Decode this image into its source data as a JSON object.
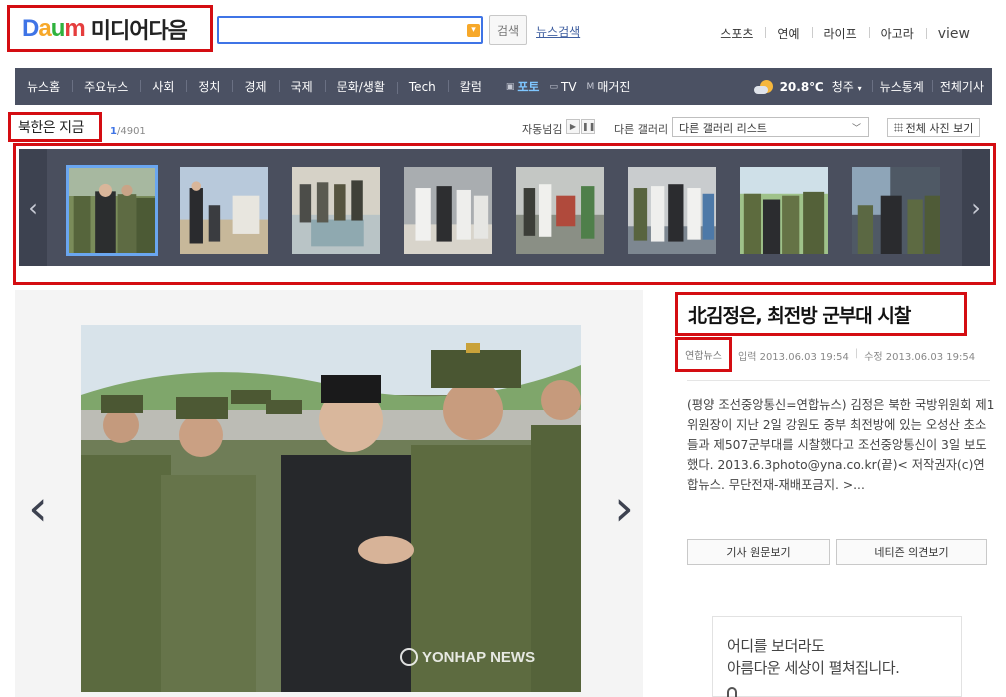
{
  "header": {
    "logo_letters": [
      "D",
      "a",
      "u",
      "m"
    ],
    "logo_media": "미디어다음",
    "search": {
      "value": "",
      "placeholder": ""
    },
    "search_button": "검색",
    "news_search_link": "뉴스검색",
    "top_nav": [
      "스포츠",
      "연예",
      "라이프",
      "아고라",
      "view"
    ]
  },
  "navbar": {
    "items": [
      "뉴스홈",
      "주요뉴스",
      "사회",
      "정치",
      "경제",
      "국제",
      "문화/생활",
      "Tech",
      "칼럼"
    ],
    "media": {
      "photo": "포토",
      "tv": "TV",
      "magazine": "매거진"
    },
    "weather": {
      "icon": "partly-cloudy-icon",
      "temperature": "20.8℃",
      "location": "청주"
    },
    "right_links": [
      "뉴스통계",
      "전체기사"
    ]
  },
  "gallery": {
    "title": "북한은 지금",
    "current": "1",
    "total": "/4901",
    "autoplay_label": "자동넘김",
    "other_gallery_label": "다른 갤러리",
    "select_value": "다른 갤러리 리스트",
    "all_photos_button": "전체 사진 보기",
    "thumbnails": [
      "Kim Jong-un with soldiers outdoors",
      "Kim Jong-un standing by a monument",
      "Officials inspecting a pool",
      "Kim Jong-un with doctors in white coats",
      "Officials in a factory hall",
      "Kim Jong-un touring a facility with staff",
      "Kim Jong-un greeting soldiers on a hill",
      "Kim Jong-un with soldiers at a window"
    ],
    "active_thumbnail": 0
  },
  "article": {
    "headline": "北김정은, 최전방 군부대 시찰",
    "source": "연합뉴스",
    "input_time": "입력 2013.06.03 19:54",
    "edit_time": "수정 2013.06.03 19:54",
    "body": "(평양 조선중앙통신=연합뉴스) 김정은 북한 국방위원회 제1위원장이 지난 2일 강원도 중부 최전방에 있는 오성산 초소들과 제507군부대를 시찰했다고 조선중앙통신이 3일 보도했다. 2013.6.3photo@yna.co.kr(끝)< 저작권자(c)연합뉴스. 무단전재-재배포금지. >...",
    "original_button": "기사 원문보기",
    "comments_button": "네티즌 의견보기"
  },
  "photo": {
    "watermark": "YONHAP NEWS"
  },
  "ad": {
    "line1": "어디를 보더라도",
    "line2": "아름다운 세상이 펼쳐집니다."
  },
  "colors": {
    "highlight": "#d40d12",
    "navbar": "#4b5163",
    "accent": "#3f74e6"
  }
}
